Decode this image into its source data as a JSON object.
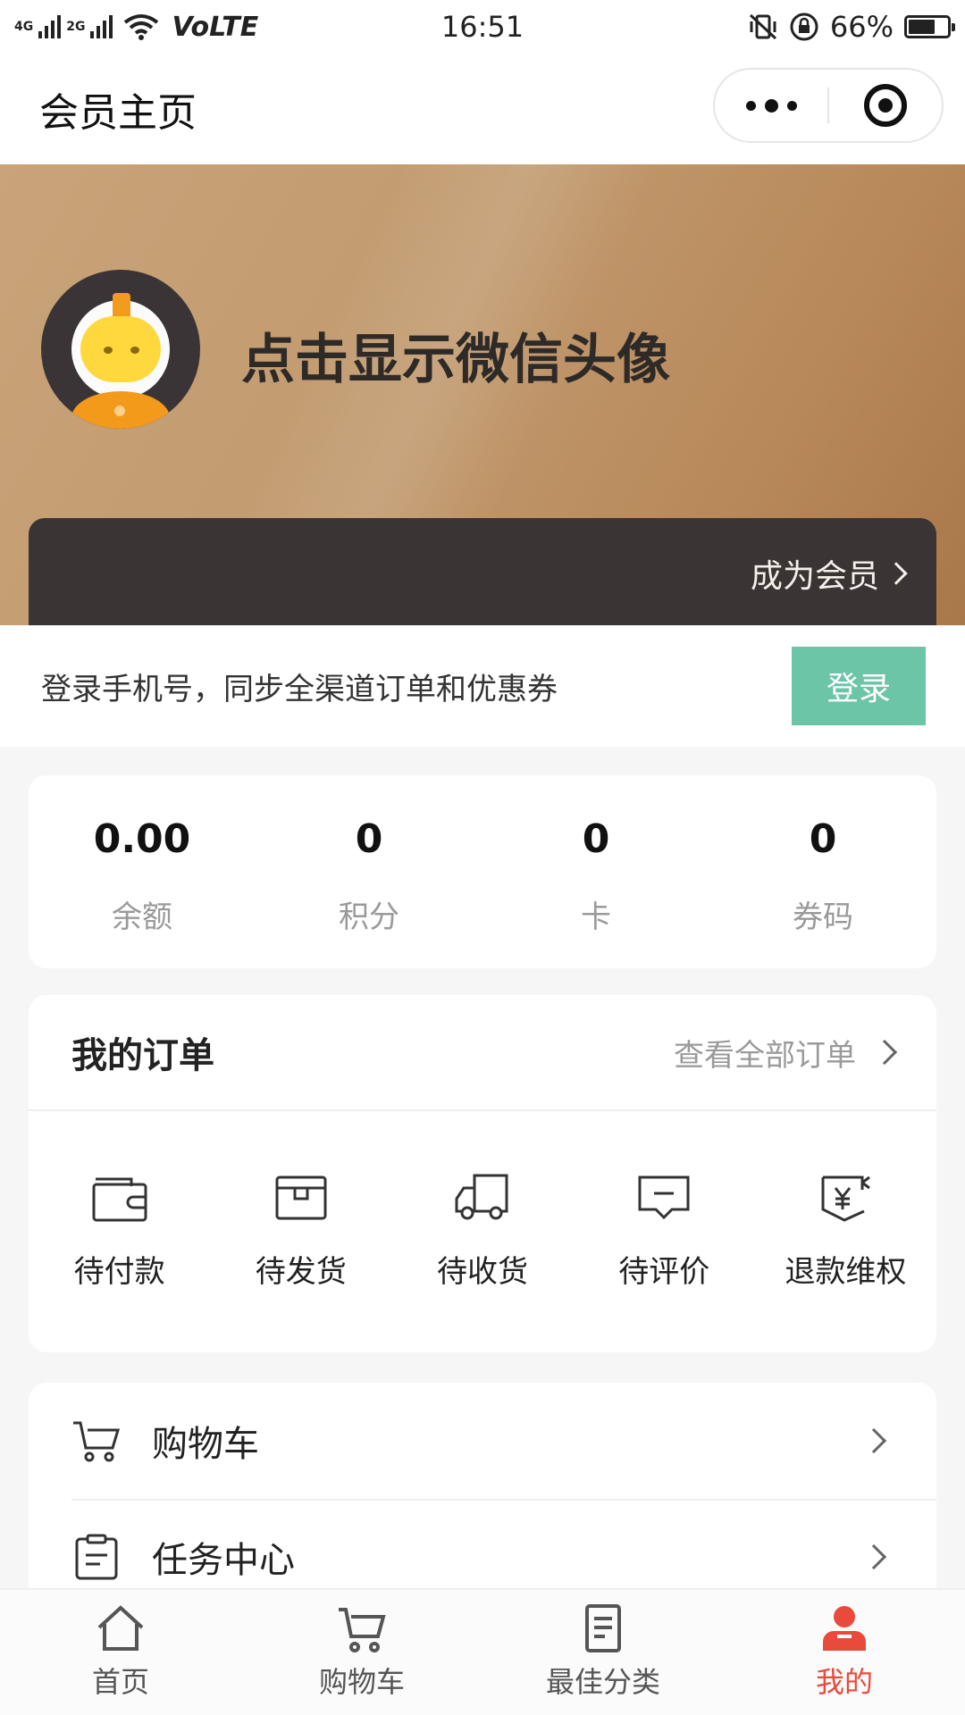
{
  "status_bar": {
    "network_1": "4G",
    "network_2": "2G",
    "volte": "VoLTE",
    "time": "16:51",
    "battery": "66%",
    "battery_level": 0.66
  },
  "navbar": {
    "title": "会员主页"
  },
  "hero": {
    "name_prompt": "点击显示微信头像",
    "member_link": "成为会员"
  },
  "login": {
    "text": "登录手机号，同步全渠道订单和优惠券",
    "button": "登录",
    "button_color": "#6cc5a6"
  },
  "stats": [
    {
      "value": "0.00",
      "label": "余额"
    },
    {
      "value": "0",
      "label": "积分"
    },
    {
      "value": "0",
      "label": "卡"
    },
    {
      "value": "0",
      "label": "券码"
    }
  ],
  "orders": {
    "title": "我的订单",
    "view_all": "查看全部订单",
    "items": [
      {
        "label": "待付款",
        "icon": "wallet-icon"
      },
      {
        "label": "待发货",
        "icon": "box-icon"
      },
      {
        "label": "待收货",
        "icon": "truck-icon"
      },
      {
        "label": "待评价",
        "icon": "comment-icon"
      },
      {
        "label": "退款维权",
        "icon": "refund-icon"
      }
    ]
  },
  "menu": [
    {
      "label": "购物车",
      "icon": "cart-icon"
    },
    {
      "label": "任务中心",
      "icon": "clipboard-icon"
    }
  ],
  "tabbar": {
    "active_color": "#e84a3c",
    "items": [
      {
        "label": "首页",
        "icon": "home-icon"
      },
      {
        "label": "购物车",
        "icon": "cart-icon"
      },
      {
        "label": "最佳分类",
        "icon": "list-doc-icon"
      },
      {
        "label": "我的",
        "icon": "user-icon"
      }
    ]
  }
}
